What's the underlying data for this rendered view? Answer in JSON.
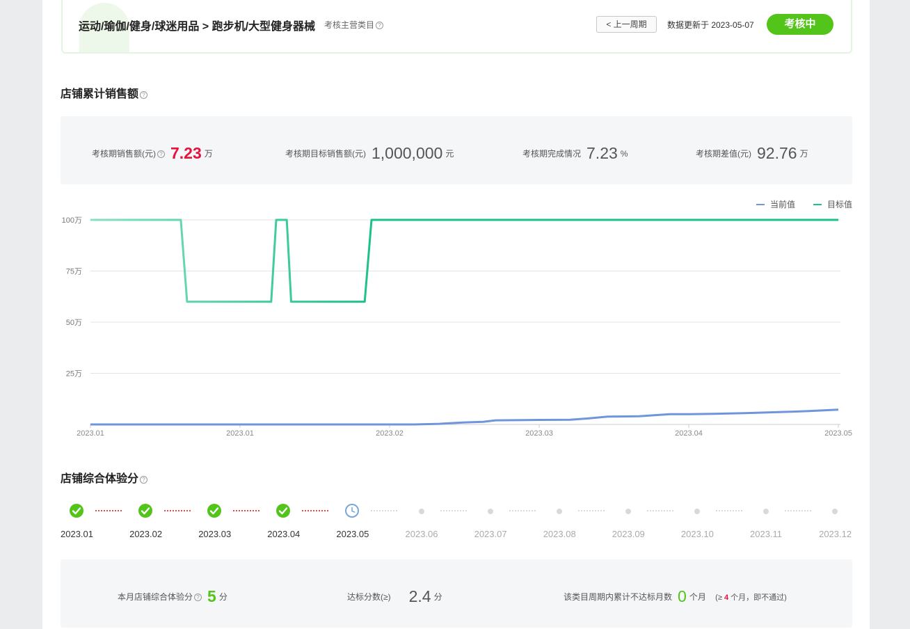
{
  "header": {
    "breadcrumb": "运动/瑜伽/健身/球迷用品 > 跑步机/大型健身器械",
    "main_category_label": "考核主营类目",
    "prev_period_button": "< 上一周期",
    "updated_text": "数据更新于 2023-05-07",
    "status_badge": "考核中"
  },
  "sales": {
    "title": "店铺累计销售额",
    "stats": [
      {
        "label": "考核期销售额(元)",
        "value": "7.23",
        "unit": "万"
      },
      {
        "label": "考核期目标销售额(元)",
        "value": "1,000,000",
        "unit": "元"
      },
      {
        "label": "考核期完成情况",
        "value": "7.23",
        "unit": "%"
      },
      {
        "label": "考核期差值(元)",
        "value": "92.76",
        "unit": "万"
      }
    ]
  },
  "colors": {
    "accent_green": "#52c41a",
    "alert_red": "#e4133d",
    "target_line": "#1cc189",
    "target_line_faded": "#88e0c0",
    "current_line": "#6f95dc"
  },
  "chart_data": {
    "type": "line",
    "legend": [
      "当前值",
      "目标值"
    ],
    "legend_position": "top-right",
    "ylim": [
      0,
      100
    ],
    "y_ticks": [
      "25万",
      "50万",
      "75万",
      "100万"
    ],
    "y_tick_values": [
      25,
      50,
      75,
      100
    ],
    "x_tick_labels": [
      "2023.01",
      "2023.01",
      "2023.02",
      "2023.03",
      "2023.04",
      "2023.05"
    ],
    "x_range": [
      0,
      120
    ],
    "x_tick_positions": [
      0,
      24,
      48,
      72,
      96,
      120
    ],
    "grid": true,
    "series": [
      {
        "name": "目标值",
        "x": [
          0,
          14.5,
          15.5,
          29,
          29.8,
          31.5,
          32.2,
          44,
          45.1,
          120
        ],
        "values": [
          100,
          100,
          60,
          60,
          100,
          100,
          60,
          60,
          100,
          100
        ]
      },
      {
        "name": "当前值",
        "x": [
          0,
          52,
          56,
          60,
          63,
          65,
          72,
          77,
          80,
          83,
          88,
          93,
          96,
          100,
          105,
          110,
          115,
          120
        ],
        "values": [
          0,
          0,
          0.3,
          1,
          1.3,
          2,
          2.2,
          2.3,
          3,
          3.8,
          4,
          5,
          5,
          5.2,
          5.5,
          6,
          6.5,
          7.23
        ]
      }
    ]
  },
  "experience": {
    "title": "店铺综合体验分",
    "months": [
      {
        "label": "2023.01",
        "state": "passed"
      },
      {
        "label": "2023.02",
        "state": "passed"
      },
      {
        "label": "2023.03",
        "state": "passed"
      },
      {
        "label": "2023.04",
        "state": "passed"
      },
      {
        "label": "2023.05",
        "state": "pending"
      },
      {
        "label": "2023.06",
        "state": "future"
      },
      {
        "label": "2023.07",
        "state": "future"
      },
      {
        "label": "2023.08",
        "state": "future"
      },
      {
        "label": "2023.09",
        "state": "future"
      },
      {
        "label": "2023.10",
        "state": "future"
      },
      {
        "label": "2023.11",
        "state": "future"
      },
      {
        "label": "2023.12",
        "state": "future"
      }
    ],
    "score_label": "本月店铺综合体验分",
    "score_value": "5",
    "score_unit": "分",
    "threshold_label": "达标分数(≥)",
    "threshold_value": "2.4",
    "threshold_unit": "分",
    "fail_months_label": "该类目周期内累计不达标月数",
    "fail_months_value": "0",
    "fail_months_unit": "个月",
    "rule_prefix": "(≥",
    "rule_count": "4",
    "rule_suffix": "个月，即不通过)"
  }
}
